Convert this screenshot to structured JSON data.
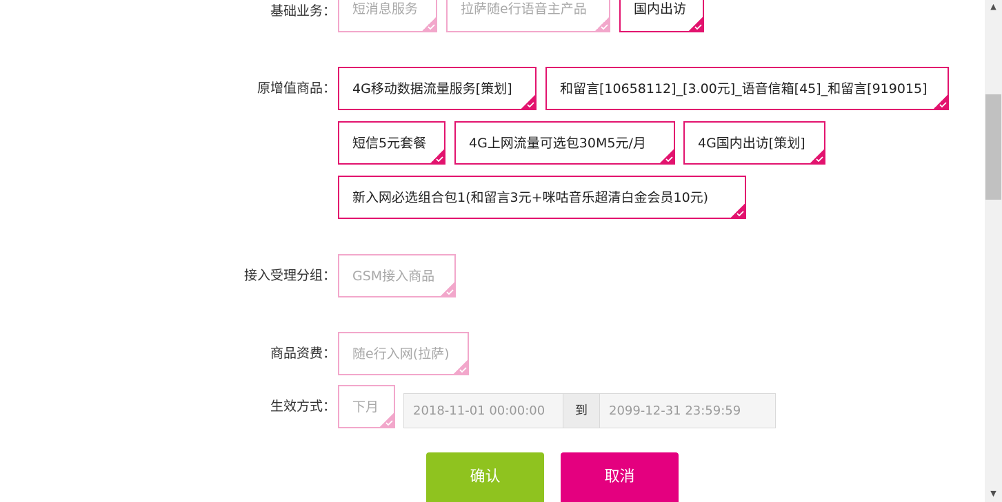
{
  "basic_business": {
    "label": "基础业务：",
    "options": [
      {
        "text": "短消息服务",
        "disabled": true
      },
      {
        "text": "拉萨随e行语音主产品",
        "disabled": true
      },
      {
        "text": "国内出访",
        "disabled": false
      }
    ]
  },
  "vas_products": {
    "label": "原增值商品：",
    "options": [
      {
        "text": "4G移动数据流量服务[策划]"
      },
      {
        "text": "和留言[10658112]_[3.00元]_语音信箱[45]_和留言[919015]"
      },
      {
        "text": "短信5元套餐"
      },
      {
        "text": "4G上网流量可选包30M5元/月"
      },
      {
        "text": "4G国内出访[策划]"
      },
      {
        "text": "新入网必选组合包1(和留言3元+咪咕音乐超清白金会员10元)"
      }
    ]
  },
  "access_group": {
    "label": "接入受理分组：",
    "option": "GSM接入商品"
  },
  "tariff": {
    "label": "商品资费：",
    "option": "随e行入网(拉萨)"
  },
  "effective": {
    "label": "生效方式：",
    "option": "下月",
    "start": "2018-11-01 00:00:00",
    "to": "到",
    "end": "2099-12-31 23:59:59"
  },
  "buttons": {
    "confirm": "确认",
    "cancel": "取消"
  },
  "colors": {
    "accent": "#e2136e",
    "accent_light": "#f2a7cb",
    "confirm": "#8fc31f",
    "cancel": "#e4007f"
  },
  "icons": {
    "selected_corner": "check-corner-icon",
    "scroll_up": "chevron-up-icon",
    "scroll_down": "chevron-down-icon"
  }
}
